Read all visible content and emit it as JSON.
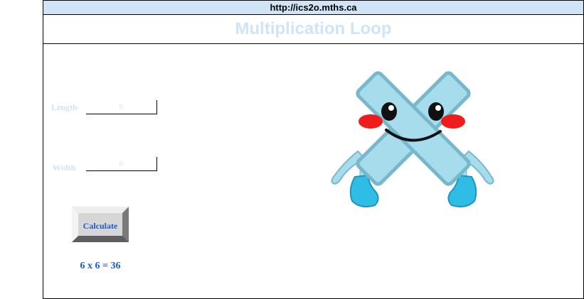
{
  "browser": {
    "url": "http://ics2o.mths.ca"
  },
  "page": {
    "title": "Multiplication Loop"
  },
  "form": {
    "length_label": "Length",
    "length_value": "6",
    "width_label": "Width",
    "width_value": "6",
    "calculate_label": "Calculate"
  },
  "output": {
    "result_text": "6 x 6 = 36"
  },
  "mascot": {
    "icon": "multiplication-sign-mascot-icon",
    "body_color": "#a6dcec",
    "outline_color": "#78b8cc",
    "boot_color": "#2fbde6",
    "cheek_color": "#ee1c1c"
  },
  "colors": {
    "url_bar_background": "#cfe4f7",
    "title_text": "#cfe4f7",
    "accent_blue": "#1b5bd1"
  }
}
